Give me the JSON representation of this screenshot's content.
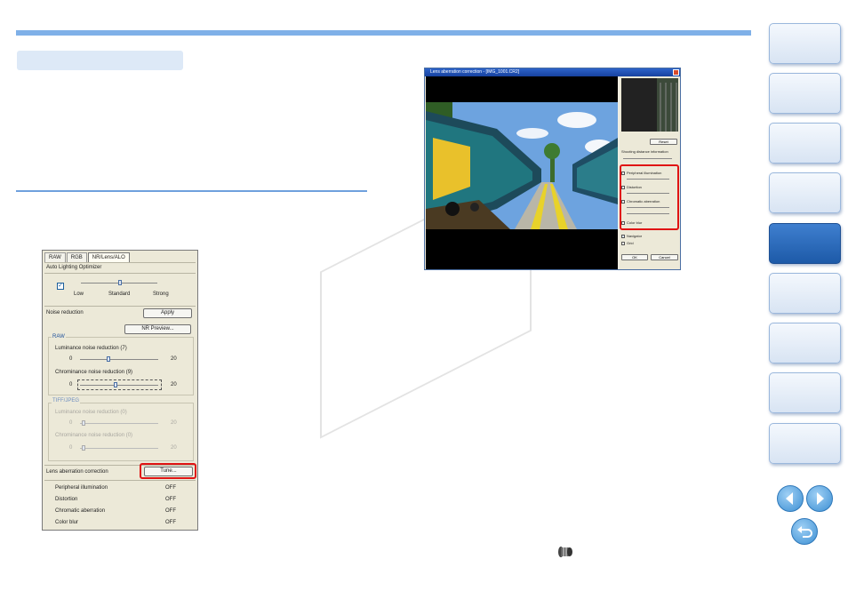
{
  "nav": {
    "tabs": [
      {
        "active": false
      },
      {
        "active": false
      },
      {
        "active": false
      },
      {
        "active": false
      },
      {
        "active": true
      },
      {
        "active": false
      },
      {
        "active": false
      },
      {
        "active": false
      },
      {
        "active": false
      }
    ],
    "prev_icon": "left-arrow-icon",
    "next_icon": "right-arrow-icon",
    "return_icon": "return-icon",
    "active_color": "#2664b8",
    "accent_color": "#7fb0e8"
  },
  "panel": {
    "tabs": [
      "RAW",
      "RGB",
      "NR/Lens/ALO"
    ],
    "alo_title": "Auto Lighting Optimizer",
    "alo_levels": [
      "Low",
      "Standard",
      "Strong"
    ],
    "noise_reduction_label": "Noise reduction",
    "apply_label": "Apply",
    "nr_preview_label": "NR Preview...",
    "raw_group": "RAW",
    "raw_luminance": "Luminance noise reduction (7)",
    "raw_chrominance": "Chrominance noise reduction (9)",
    "range_min": "0",
    "range_max": "20",
    "tiff_group": "TIFF/JPEG",
    "tiff_luminance": "Luminance noise reduction (0)",
    "tiff_chrominance": "Chrominance noise reduction (0)",
    "lens_label": "Lens aberration correction",
    "tune_label": "Tune...",
    "aberrations": [
      {
        "name": "Peripheral illumination",
        "value": "OFF"
      },
      {
        "name": "Distortion",
        "value": "OFF"
      },
      {
        "name": "Chromatic aberration",
        "value": "OFF"
      },
      {
        "name": "Color blur",
        "value": "OFF"
      }
    ]
  },
  "dialog": {
    "title": "Lens aberration correction - [IMG_1001.CR2]",
    "reset_label": "Reset",
    "shooting_distance": "Shooting distance information",
    "options": [
      "Peripheral illumination",
      "Distortion",
      "Chromatic aberration",
      "Color blur"
    ],
    "navigator_label": "Navigator",
    "grid_label": "Grid",
    "ok_label": "OK",
    "cancel_label": "Cancel"
  },
  "highlight_color": "#e01414",
  "lens_icon": "lens-icon"
}
